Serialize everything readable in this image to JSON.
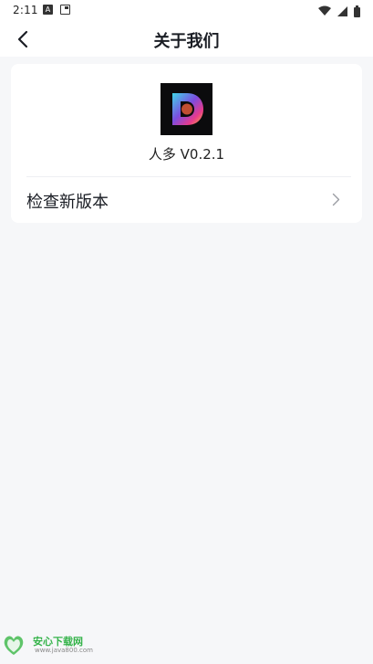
{
  "status_bar": {
    "time": "2:11",
    "left_icons": [
      "a-badge-icon",
      "card-icon"
    ],
    "right_icons": [
      "wifi-icon",
      "cell-signal-icon",
      "battery-icon"
    ]
  },
  "nav": {
    "title": "关于我们",
    "back_icon": "chevron-left-icon"
  },
  "about": {
    "logo_icon": "app-logo-d",
    "version": "人多 V0.2.1",
    "check_update_label": "检查新版本",
    "chevron_icon": "chevron-right-icon"
  },
  "watermark": {
    "text": "安心下载网",
    "url": "www.java800.com"
  },
  "colors": {
    "background": "#f6f7f9",
    "card": "#ffffff",
    "text": "#1a1d24",
    "watermark_green": "#35b34a"
  }
}
